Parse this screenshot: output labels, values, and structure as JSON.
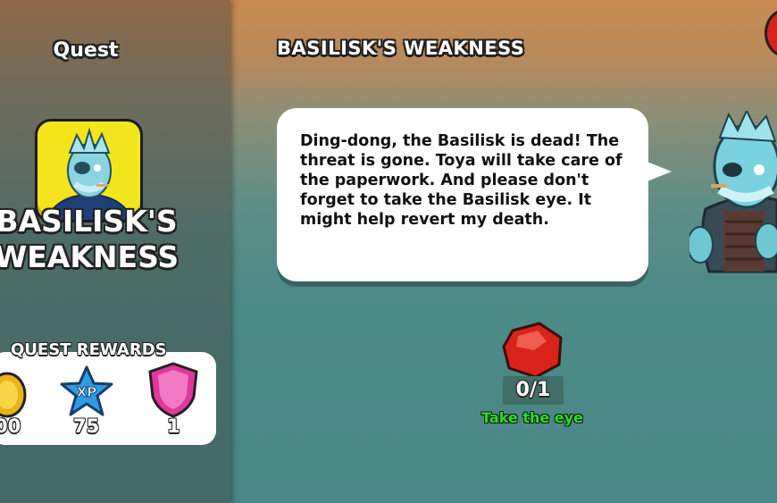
{
  "left_panel": {
    "title": "Quest",
    "quest_name_line1": "BASILISK'S",
    "quest_name_line2": "WEAKNESS",
    "quest_icon": "ghost-pirate-portrait-icon"
  },
  "rewards": {
    "title": "QUEST REWARDS",
    "items": [
      {
        "icon": "gold-coin-icon",
        "value": "00"
      },
      {
        "icon": "xp-star-icon",
        "value": "75",
        "badge": "XP"
      },
      {
        "icon": "pink-gem-shield-icon",
        "value": "1"
      }
    ]
  },
  "main": {
    "title": "BASILISK'S WEAKNESS",
    "dialogue": "Ding-dong, the Basilisk is dead! The threat is gone. Toya will take care of the paperwork. And please don't forget to take the Basilisk eye. It might help revert my death.",
    "speaker_icon": "ghost-pirate-character-icon"
  },
  "objective": {
    "icon": "red-gem-icon",
    "progress": "0/1",
    "label": "Take the eye"
  },
  "colors": {
    "accent_yellow": "#f2e51b",
    "objective_green": "#27e027",
    "gem_red": "#d8231b"
  }
}
